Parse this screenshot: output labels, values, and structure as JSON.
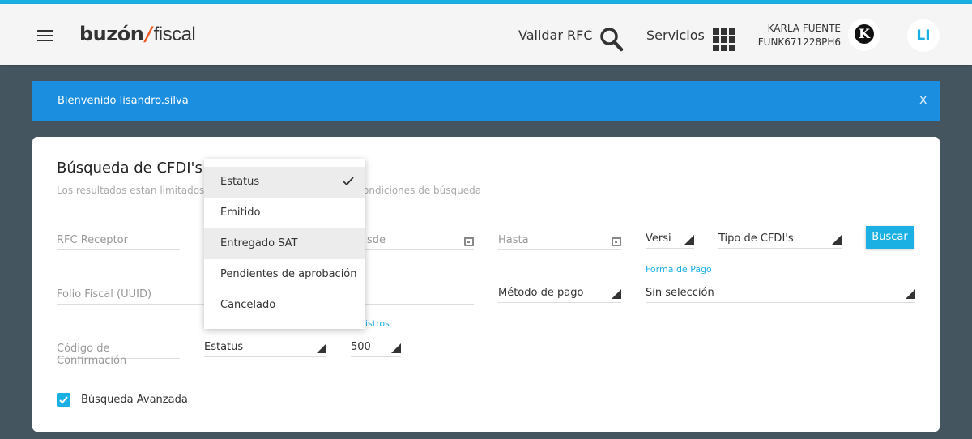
{
  "header": {
    "logo_part1": "buzón",
    "logo_part2": "fiscal",
    "validar_rfc": "Validar RFC",
    "servicios": "Servicios",
    "user_name": "KARLA FUENTE",
    "user_rfc": "FUNK671228PH6",
    "avatar_k": "K",
    "avatar_initials": "LI"
  },
  "banner": {
    "message": "Bienvenido lisandro.silva",
    "close": "X"
  },
  "search": {
    "title": "Búsqueda de CFDI's",
    "subtitle_left": "Los resultados estan limitados a",
    "subtitle_right": "ondiciones de búsqueda",
    "rfc_receptor": "RFC Receptor",
    "desde_partial": "sde",
    "hasta": "Hasta",
    "version": "Versi",
    "tipo_cfdi": "Tipo de CFDI's",
    "buscar": "Buscar",
    "folio_fiscal": "Folio Fiscal (UUID)",
    "metodo_pago": "Método de pago",
    "forma_pago_label": "Forma de Pago",
    "forma_pago_value": "Sin selección",
    "codigo_confirmacion": "Código de Confirmación",
    "estatus_value": "Estatus",
    "registros_label_partial": "gistros",
    "registros_value": "500",
    "busqueda_avanzada": "Búsqueda Avanzada"
  },
  "dropdown": {
    "items": [
      "Estatus",
      "Emitido",
      "Entregado SAT",
      "Pendientes de aprobación",
      "Cancelado"
    ],
    "selected": "Estatus",
    "highlighted": "Entregado SAT"
  },
  "colors": {
    "accent": "#1ab0e3",
    "banner": "#1c8ee0",
    "background": "#455560",
    "logo_slash": "#ee5a24"
  }
}
